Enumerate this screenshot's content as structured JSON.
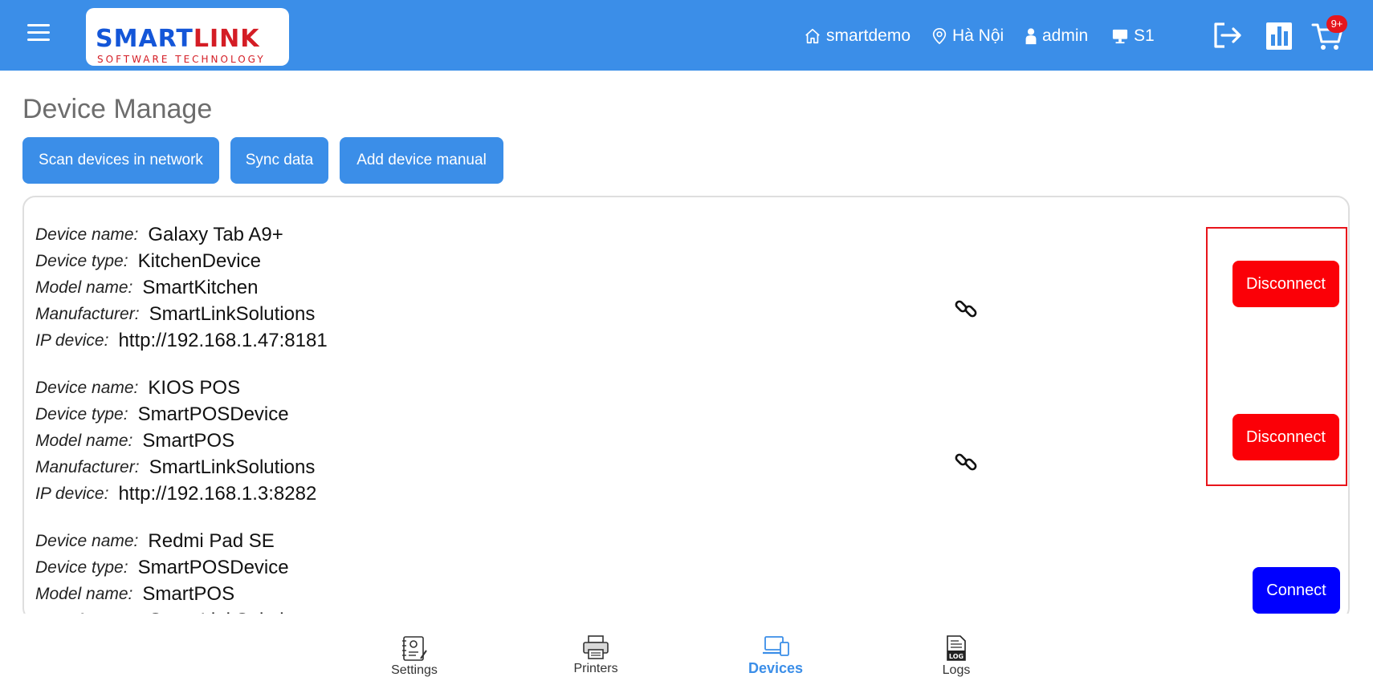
{
  "header": {
    "logo": {
      "brand_smart": "SMART",
      "brand_link": "LINK",
      "tagline": "SOFTWARE TECHNOLOGY"
    },
    "store": "smartdemo",
    "location": "Hà Nội",
    "user": "admin",
    "station": "S1",
    "cart_badge": "9+"
  },
  "page": {
    "title": "Device Manage",
    "buttons": {
      "scan": "Scan devices in network",
      "sync": "Sync data",
      "add": "Add device manual"
    }
  },
  "labels": {
    "device_name": "Device name:",
    "device_type": "Device type:",
    "model_name": "Model name:",
    "manufacturer": "Manufacturer:",
    "ip_device": "IP device:"
  },
  "devices": [
    {
      "name": "Galaxy Tab A9+",
      "type": "KitchenDevice",
      "model": "SmartKitchen",
      "manufacturer": "SmartLinkSolutions",
      "ip": "http://192.168.1.47:8181",
      "action": "Disconnect"
    },
    {
      "name": "KIOS POS",
      "type": "SmartPOSDevice",
      "model": "SmartPOS",
      "manufacturer": "SmartLinkSolutions",
      "ip": "http://192.168.1.3:8282",
      "action": "Disconnect"
    },
    {
      "name": "Redmi Pad SE",
      "type": "SmartPOSDevice",
      "model": "SmartPOS",
      "manufacturer": "SmartLinkSolutions",
      "action": "Connect"
    }
  ],
  "bottom_nav": {
    "settings": "Settings",
    "printers": "Printers",
    "devices": "Devices",
    "logs": "Logs",
    "active": "devices"
  },
  "colors": {
    "primary": "#3b8ee8",
    "disconnect": "#fb0007",
    "connect": "#0000ff",
    "highlight": "#e8141b"
  }
}
